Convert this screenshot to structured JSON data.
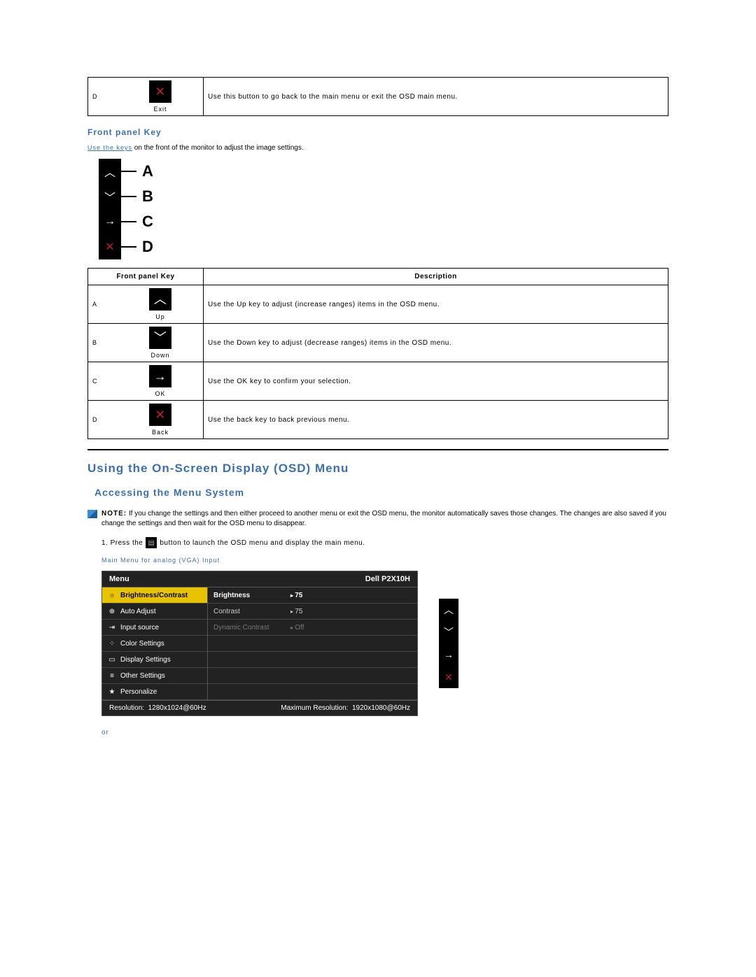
{
  "exit_table": {
    "letter": "D",
    "label": "Exit",
    "desc": "Use this button to go back to the main menu or exit the OSD main menu."
  },
  "front_panel_title": "Front panel Key",
  "use_keys_link": "Use the keys",
  "use_keys_rest": " on the front of the monitor to adjust the image settings.",
  "diagram_labels": [
    "A",
    "B",
    "C",
    "D"
  ],
  "keytable": {
    "col1": "Front panel Key",
    "col2": "Description",
    "rows": [
      {
        "letter": "A",
        "label": "Up",
        "desc": "Use the Up key to adjust (increase ranges) items in the OSD menu."
      },
      {
        "letter": "B",
        "label": "Down",
        "desc": "Use the Down key to adjust (decrease ranges) items in the OSD menu."
      },
      {
        "letter": "C",
        "label": "OK",
        "desc": "Use the OK key to confirm your selection."
      },
      {
        "letter": "D",
        "label": "Back",
        "desc": "Use the back key to back previous menu."
      }
    ]
  },
  "osd_heading": "Using the On-Screen Display (OSD) Menu",
  "access_heading": "Accessing the Menu System",
  "note_label": "NOTE:",
  "note_text": "If you change the settings and then either proceed to another menu or exit the OSD menu, the monitor automatically saves those changes. The changes are also saved if you change the settings and then wait for the OSD menu to disappear.",
  "step1_a": "1. Press the",
  "step1_b": "button to launch the OSD menu and display the main menu.",
  "main_menu_label": "Main Menu for analog (VGA) Input",
  "osd": {
    "menu_label": "Menu",
    "model": "Dell P2X10H",
    "left_items": [
      "Brightness/Contrast",
      "Auto Adjust",
      "Input source",
      "Color Settings",
      "Display Settings",
      "Other Settings",
      "Personalize"
    ],
    "right_rows": [
      {
        "lbl": "Brightness",
        "val": "75"
      },
      {
        "lbl": "Contrast",
        "val": "75"
      },
      {
        "lbl": "Dynamic Contrast",
        "val": "Off"
      }
    ],
    "footer": {
      "res_label": "Resolution:",
      "res_val": "1280x1024@60Hz",
      "max_label": "Maximum Resolution:",
      "max_val": "1920x1080@60Hz"
    }
  },
  "or_text": "or"
}
